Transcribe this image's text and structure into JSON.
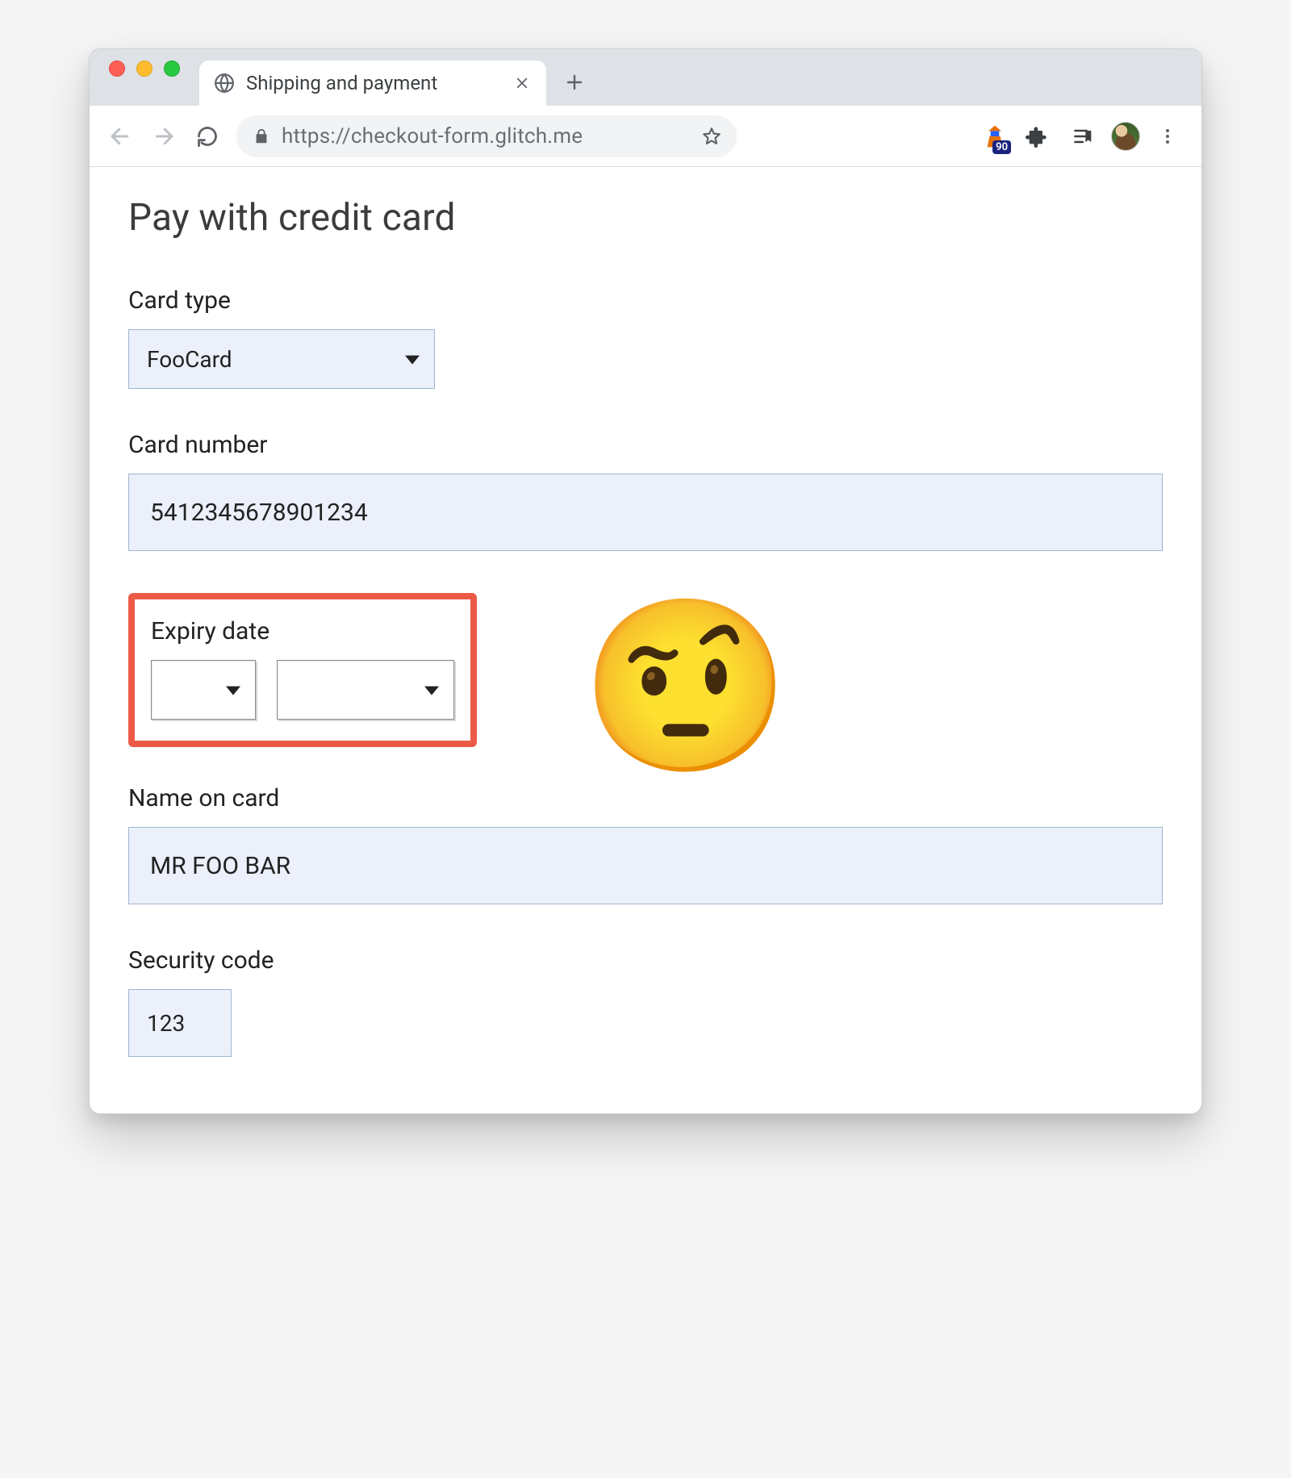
{
  "browser": {
    "tab_title": "Shipping and payment",
    "url_display": "https://checkout-form.glitch.me",
    "lighthouse_score": "90"
  },
  "page": {
    "heading": "Pay with credit card",
    "card_type": {
      "label": "Card type",
      "selected": "FooCard"
    },
    "card_number": {
      "label": "Card number",
      "value": "5412345678901234"
    },
    "expiry": {
      "label": "Expiry date",
      "month_value": "",
      "year_value": ""
    },
    "name_on_card": {
      "label": "Name on card",
      "value": "MR FOO BAR"
    },
    "security_code": {
      "label": "Security code",
      "value": "123"
    },
    "emoji": "🤨"
  }
}
